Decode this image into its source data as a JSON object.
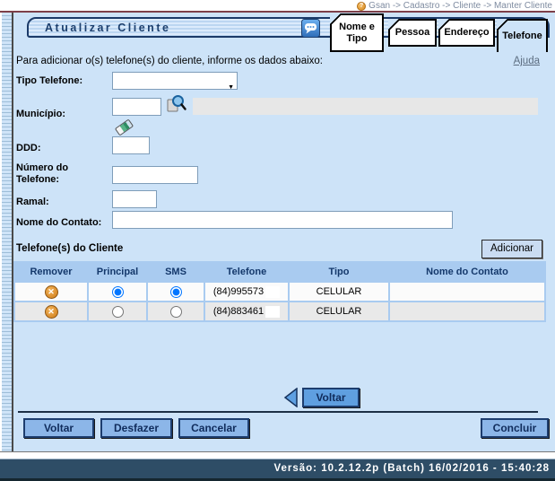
{
  "breadcrumb": {
    "path": "Gsan -> Cadastro -> Cliente -> Manter Cliente"
  },
  "header": {
    "title": "Atualizar Cliente"
  },
  "tabs": [
    {
      "label": "Nome e Tipo"
    },
    {
      "label": "Pessoa"
    },
    {
      "label": "Endereço"
    },
    {
      "label": "Telefone"
    }
  ],
  "form": {
    "instruction": "Para adicionar o(s) telefone(s) do cliente, informe os dados abaixo:",
    "help_link": "Ajuda",
    "tipo_telefone": {
      "label": "Tipo Telefone:",
      "value": ""
    },
    "municipio": {
      "label": "Município:",
      "code_value": "",
      "name_value": ""
    },
    "ddd": {
      "label": "DDD:",
      "value": ""
    },
    "numero_telefone": {
      "label": "Número do Telefone:",
      "value": ""
    },
    "ramal": {
      "label": "Ramal:",
      "value": ""
    },
    "nome_contato": {
      "label": "Nome do Contato:",
      "value": ""
    }
  },
  "phones": {
    "section_title": "Telefone(s) do Cliente",
    "add_button_label": "Adicionar",
    "columns": [
      "Remover",
      "Principal",
      "SMS",
      "Telefone",
      "Tipo",
      "Nome do Contato"
    ],
    "rows": [
      {
        "telefone": "(84)995573",
        "tipo": "CELULAR",
        "nome_contato": "",
        "principal": true,
        "sms": true
      },
      {
        "telefone": "(84)883461",
        "tipo": "CELULAR",
        "nome_contato": "",
        "principal": false,
        "sms": false
      }
    ]
  },
  "actions": {
    "voltar_nav_label": "Voltar",
    "voltar_label": "Voltar",
    "desfazer_label": "Desfazer",
    "cancelar_label": "Cancelar",
    "concluir_label": "Concluir"
  },
  "footer": {
    "version_text": "Versão: 10.2.12.2p (Batch) 16/02/2016 - 15:40:28"
  },
  "colors": {
    "page_blue": "#cde3f8",
    "table_header_blue": "#a9cbf0",
    "button_blue": "#8cb6e8",
    "footer_dark_blue": "#2e4d66",
    "remove_orange": "#cf7d1a"
  }
}
